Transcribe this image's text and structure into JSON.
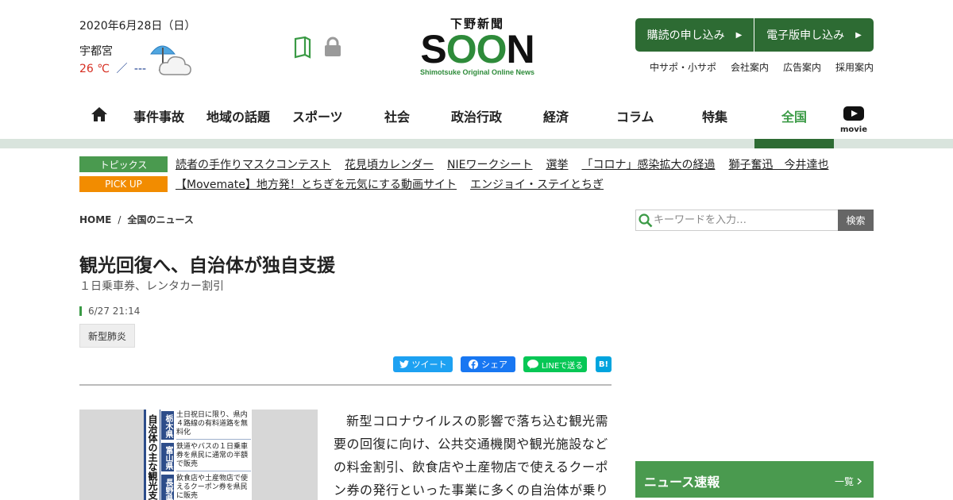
{
  "header": {
    "date": "2020年6月28日（日）",
    "city": "宇都宮",
    "temp_high": "26 ℃",
    "temp_sep": "／",
    "temp_low": "---",
    "logo_top": "下野新聞",
    "logo_main_s": "S",
    "logo_main_o1": "O",
    "logo_main_o2": "O",
    "logo_main_n": "N",
    "logo_sub": "Shimotsuke Original Online News",
    "subscribe_label": "購読の申し込み",
    "digital_label": "電子版申し込み",
    "arrow": "▶",
    "util_links": [
      "中サポ・小サポ",
      "会社案内",
      "広告案内",
      "採用案内"
    ]
  },
  "nav": {
    "items": [
      "事件事故",
      "地域の話題",
      "スポーツ",
      "社会",
      "政治行政",
      "経済",
      "コラム",
      "特集",
      "全国"
    ],
    "movie_label": "movie"
  },
  "topics": {
    "tag": "トピックス",
    "links": [
      "読者の手作りマスクコンテスト",
      "花見頃カレンダー",
      "NIEワークシート",
      "選挙",
      "「コロナ」感染拡大の経過",
      "獅子奮迅　今井達也"
    ]
  },
  "pickup": {
    "tag": "PICK UP",
    "links": [
      "【Movemate】地方発！とちぎを元気にする動画サイト",
      "エンジョイ・ステイとちぎ"
    ]
  },
  "breadcrumb": {
    "home": "HOME",
    "sep": "/",
    "current": "全国のニュース"
  },
  "search": {
    "placeholder": "キーワードを入力…",
    "button": "検索"
  },
  "article": {
    "headline": "観光回復へ、自治体が独自支援",
    "subhead": "１日乗車券、レンタカー割引",
    "timestamp": "6/27 21:14",
    "tag": "新型肺炎",
    "body": "新型コロナウイルスの影響で落ち込む観光需要の回復に向け、公共交通機関や観光施設などの料金割引、飲食店や土産物店で使えるクーポン券の発行といった事業に多くの自治体が乗り"
  },
  "share": {
    "twitter": "ツイート",
    "facebook": "シェア",
    "line": "LINEで送る",
    "hatena": "B!"
  },
  "infographic": {
    "title": "自治体の主な観光支",
    "rows": [
      {
        "pref": "栃木県",
        "text": "土日祝日に限り、県内４路線の有料道路を無料化"
      },
      {
        "pref": "富山県",
        "text": "鉄道やバスの１日乗車券を県民に通常の半額で販売"
      },
      {
        "pref": "長野県",
        "text": "飲食店や土産物店で使えるクーポン券を県民に販売"
      }
    ]
  },
  "sidebar": {
    "news_flash_title": "ニュース速報",
    "news_flash_more": "一覧"
  },
  "colors": {
    "brand_green": "#2d6b33",
    "accent_green": "#4a9a4f",
    "pickup_orange": "#f28c00",
    "temp_red": "#d62d20"
  }
}
